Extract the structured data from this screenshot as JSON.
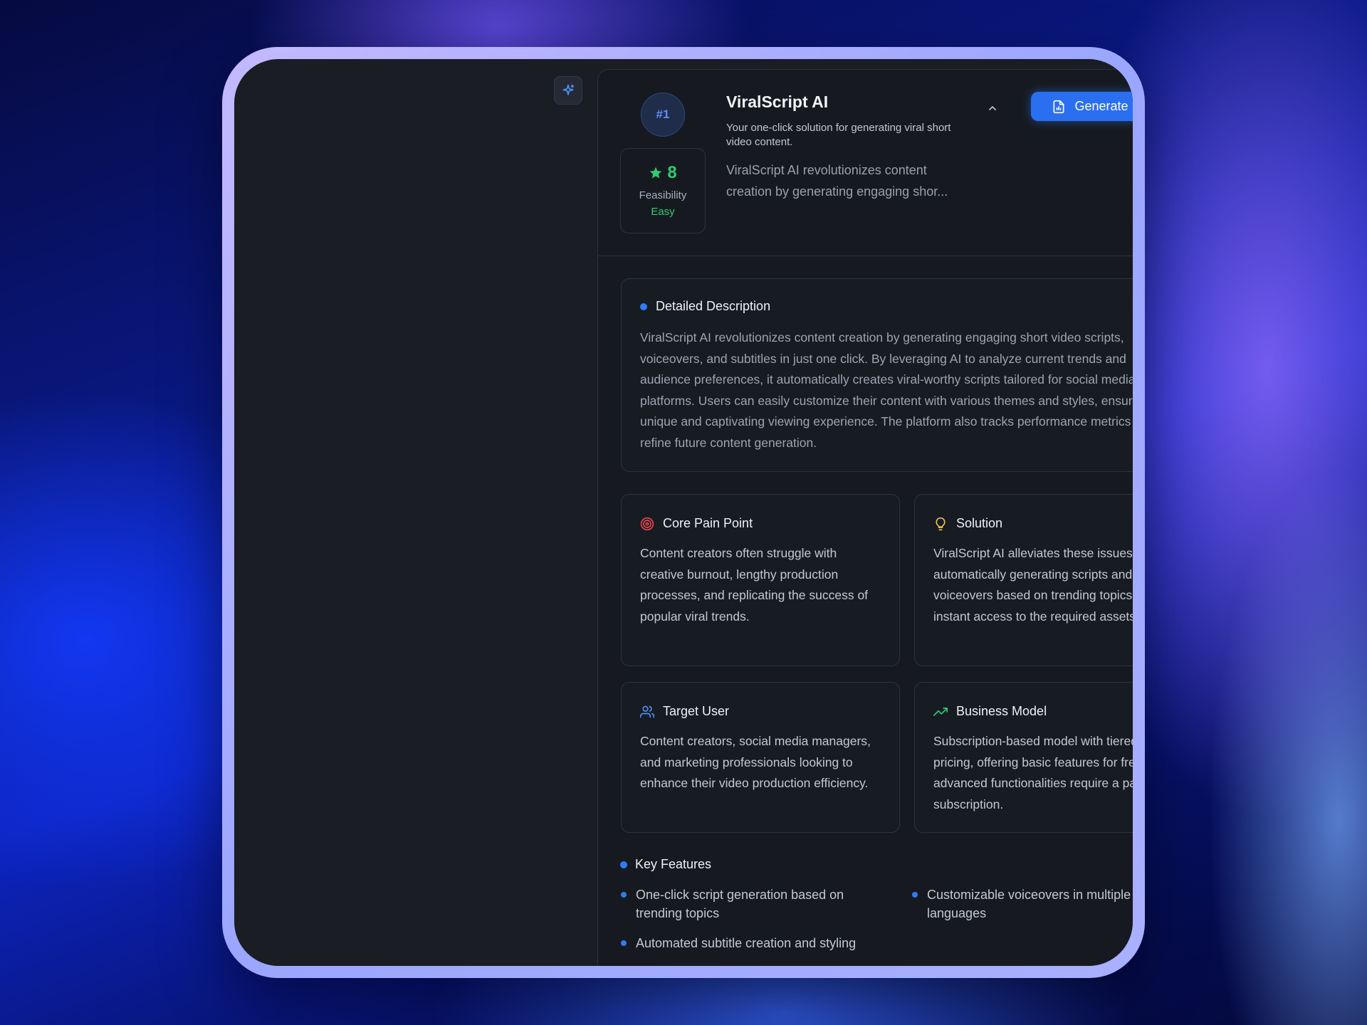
{
  "app": {
    "icon": "sparkle-icon",
    "rank": "#1",
    "title": "ViralScript AI",
    "tagline": "Your one-click solution for generating viral short video content.",
    "summary": "ViralScript AI revolutionizes content creation by generating engaging shor...",
    "score": "8",
    "score_label": "Feasibility",
    "score_level": "Easy",
    "generate_button": "Generate Prompt"
  },
  "detail": {
    "heading": "Detailed Description",
    "body": "ViralScript AI revolutionizes content creation by generating engaging short video scripts, voiceovers, and subtitles in just one click. By leveraging AI to analyze current trends and audience preferences, it automatically creates viral-worthy scripts tailored for social media platforms. Users can easily customize their content with various themes and styles, ensuring a unique and captivating viewing experience. The platform also tracks performance metrics to refine future content generation."
  },
  "pain": {
    "heading": "Core Pain Point",
    "body": "Content creators often struggle with creative burnout, lengthy production processes, and replicating the success of popular viral trends."
  },
  "solution": {
    "heading": "Solution",
    "body": "ViralScript AI alleviates these issues by automatically generating scripts and voiceovers based on trending topics, with instant access to the required assets."
  },
  "target": {
    "heading": "Target User",
    "body": "Content creators, social media managers, and marketing professionals looking to enhance their video production efficiency."
  },
  "business": {
    "heading": "Business Model",
    "body": "Subscription-based model with tiered pricing, offering basic features for free while advanced functionalities require a paid subscription."
  },
  "features": {
    "heading": "Key Features",
    "items": [
      "One-click script generation based on trending topics",
      "Customizable voiceovers in multiple languages",
      "Automated subtitle creation and styling"
    ]
  },
  "colors": {
    "accent": "#2a6ff0",
    "success": "#2ecc71",
    "pain_icon": "#e5484d",
    "solution_icon": "#f5c542",
    "target_icon": "#4f8ff7",
    "business_icon": "#2ecc71"
  }
}
